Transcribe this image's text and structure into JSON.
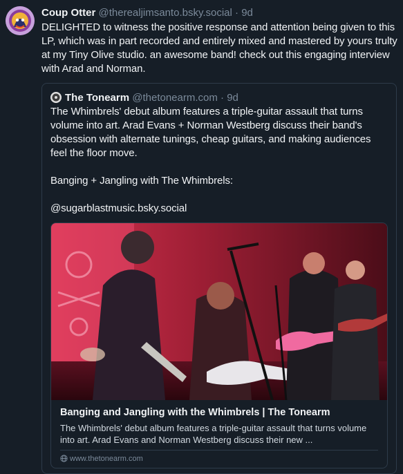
{
  "post": {
    "author_name": "Coup Otter",
    "author_handle": "@therealjimsanto.bsky.social",
    "separator": "·",
    "time": "9d",
    "text": "DELIGHTED to witness the positive response and attention being given to this LP, which was in part recorded and entirely mixed and mastered by yours trulty at my Tiny Olive studio. an awesome band! check out this engaging interview with Arad and Norman."
  },
  "quote": {
    "author_name": "The Tonearm",
    "author_handle": "@thetonearm.com",
    "separator": "·",
    "time": "9d",
    "paragraphs": [
      "The Whimbrels' debut album features a triple-guitar assault that turns volume into art. Arad Evans + Norman Westberg discuss their band's obsession with alternate tunings, cheap guitars, and making audiences feel the floor move.",
      "Banging + Jangling with The Whimbrels:",
      "@sugarblastmusic.bsky.social"
    ],
    "card": {
      "title": "Banging and Jangling with the Whimbrels | The Tonearm",
      "description": "The Whimbrels' debut album features a triple-guitar assault that turns volume into art. Arad Evans and Norman Westberg discuss their new ...",
      "domain": "www.thetonearm.com"
    }
  },
  "colors": {
    "background": "#161e27",
    "border": "#2e3b4a",
    "muted": "#7b8a9a"
  }
}
